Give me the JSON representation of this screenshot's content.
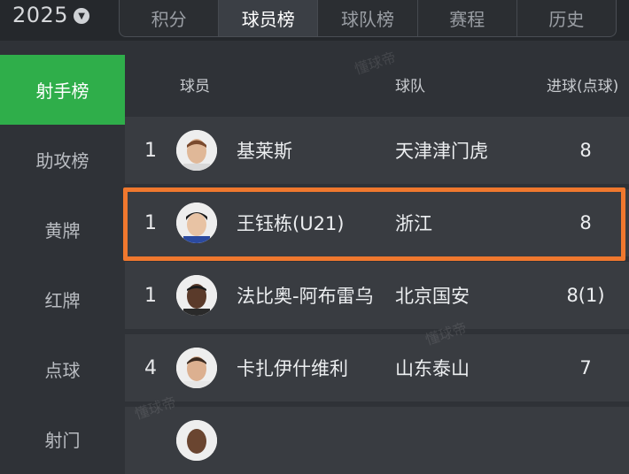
{
  "header": {
    "season": "2025",
    "tabs": [
      "积分",
      "球员榜",
      "球队榜",
      "赛程",
      "历史"
    ],
    "active_tab": 1
  },
  "sidebar": {
    "items": [
      "射手榜",
      "助攻榜",
      "黄牌",
      "红牌",
      "点球",
      "射门"
    ],
    "active_item": 0
  },
  "table": {
    "columns": {
      "player": "球员",
      "team": "球队",
      "goals": "进球(点球)"
    },
    "rows": [
      {
        "rank": "1",
        "name": "基莱斯",
        "team": "天津津门虎",
        "goals": "8"
      },
      {
        "rank": "1",
        "name": "王钰栋(U21)",
        "team": "浙江",
        "goals": "8",
        "highlighted": true
      },
      {
        "rank": "1",
        "name": "法比奥-阿布雷乌",
        "team": "北京国安",
        "goals": "8(1)"
      },
      {
        "rank": "4",
        "name": "卡扎伊什维利",
        "team": "山东泰山",
        "goals": "7"
      }
    ]
  },
  "watermark": "懂球帝",
  "colors": {
    "accent_green": "#2fae4a",
    "highlight_orange": "#f0782e",
    "background": "#2f3237"
  }
}
